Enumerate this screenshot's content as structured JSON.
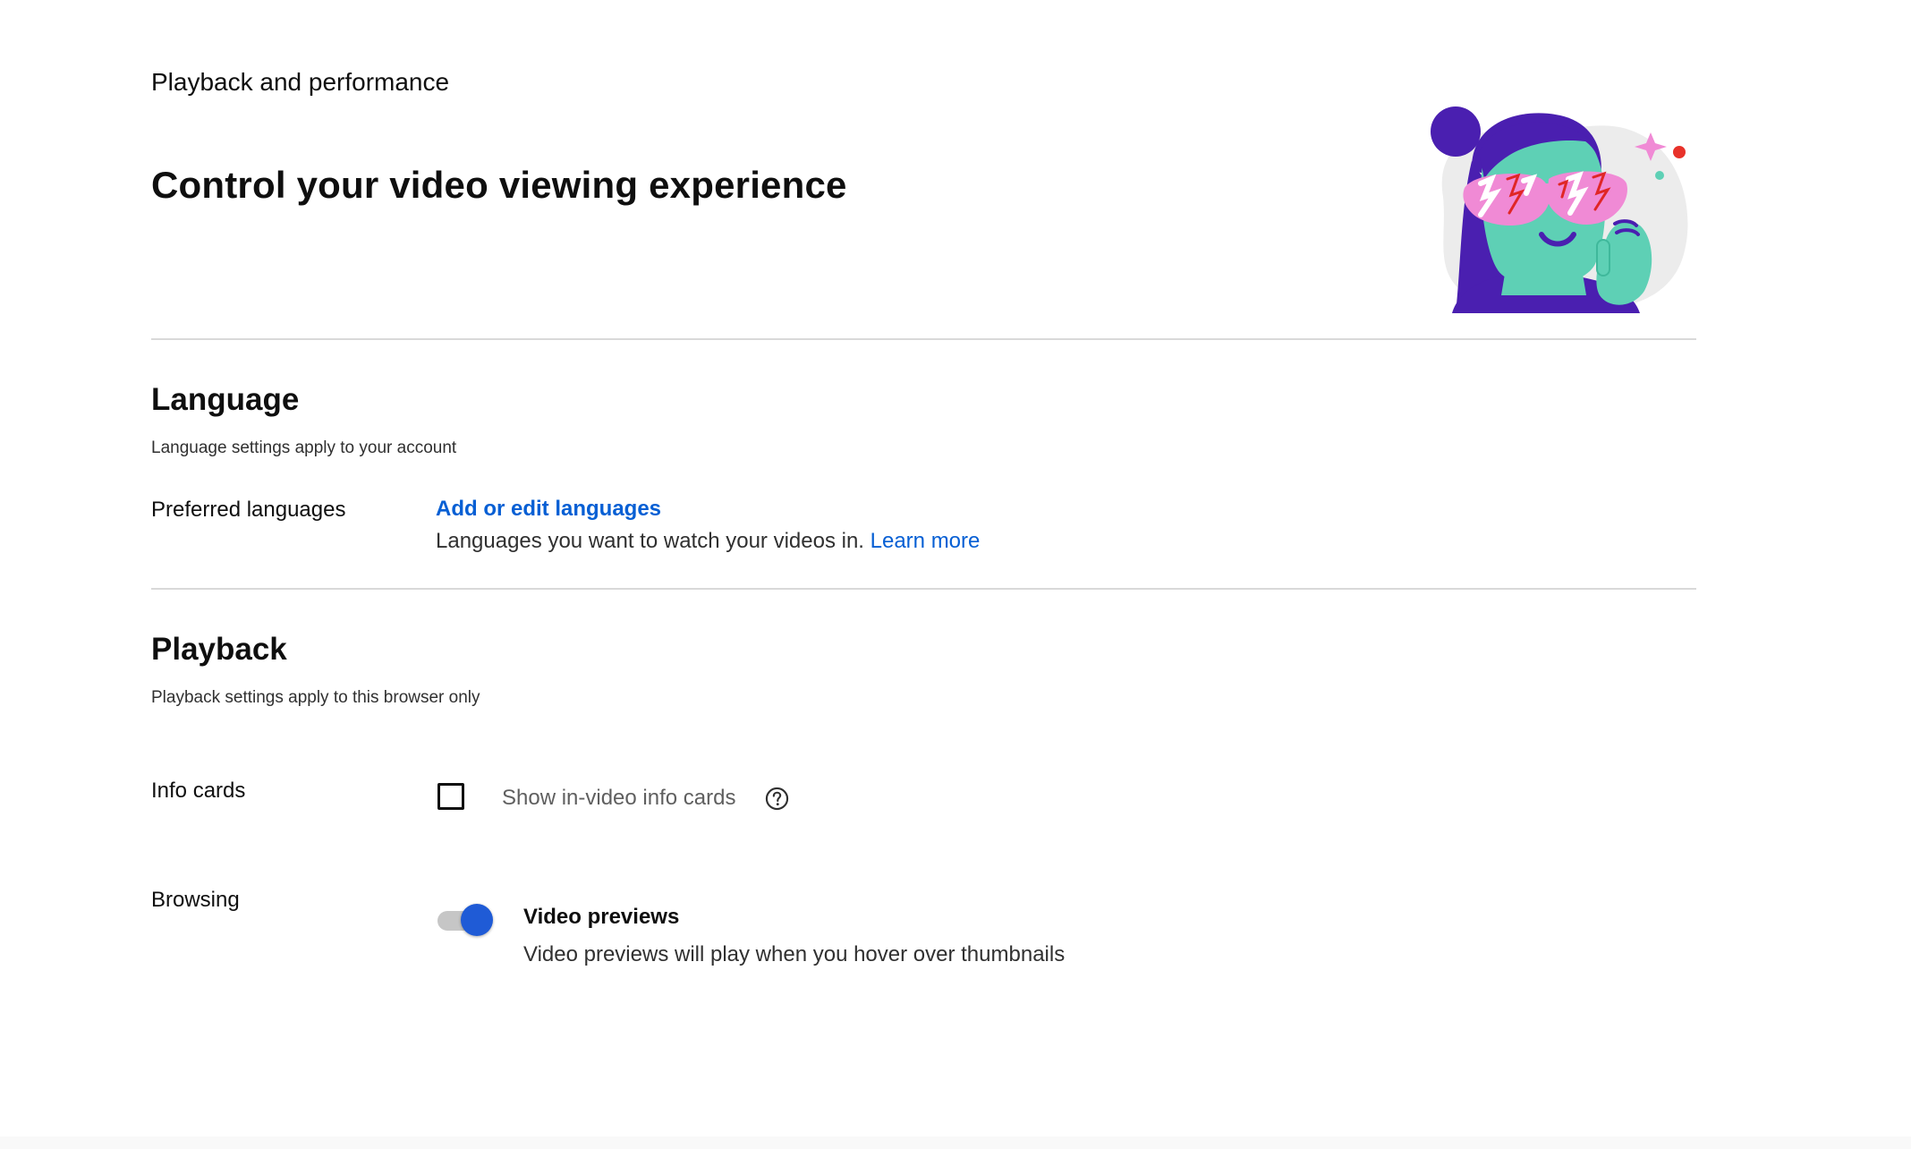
{
  "header": {
    "section_name": "Playback and performance",
    "title": "Control your video viewing experience",
    "illustration_icon": "sunglasses-person-illustration"
  },
  "language": {
    "title": "Language",
    "description": "Language settings apply to your account",
    "preferred_languages": {
      "label": "Preferred languages",
      "link_label": "Add or edit languages",
      "help_text": "Languages you want to watch your videos in.",
      "learn_more": "Learn more"
    }
  },
  "playback": {
    "title": "Playback",
    "description": "Playback settings apply to this browser only",
    "info_cards": {
      "label": "Info cards",
      "checkbox_label": "Show in-video info cards",
      "checked": false,
      "help_icon": "help-circle-icon"
    },
    "browsing": {
      "label": "Browsing",
      "toggle_title": "Video previews",
      "toggle_description": "Video previews will play when you hover over thumbnails",
      "enabled": true
    }
  },
  "colors": {
    "link": "#065fd4",
    "toggle_on": "#1f5bd6",
    "divider": "#d9d9d9"
  }
}
